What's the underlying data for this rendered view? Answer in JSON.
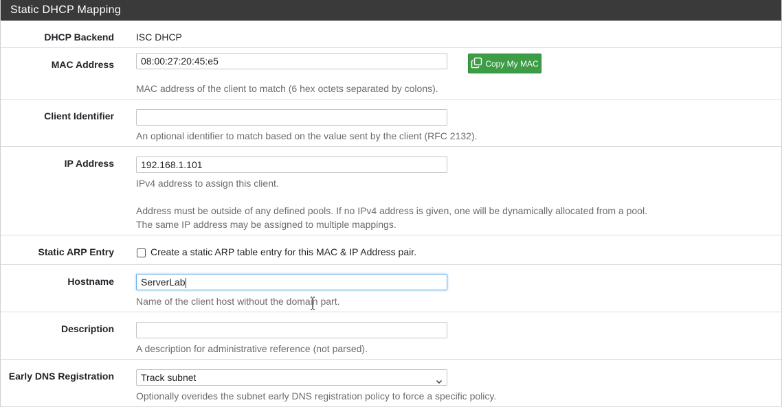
{
  "panel": {
    "title": "Static DHCP Mapping"
  },
  "backend": {
    "label": "DHCP Backend",
    "value": "ISC DHCP"
  },
  "mac": {
    "label": "MAC Address",
    "value": "08:00:27:20:45:e5",
    "button_label": "Copy My MAC",
    "help": "MAC address of the client to match (6 hex octets separated by colons)."
  },
  "client_id": {
    "label": "Client Identifier",
    "value": "",
    "help": "An optional identifier to match based on the value sent by the client (RFC 2132)."
  },
  "ip": {
    "label": "IP Address",
    "value": "192.168.1.101",
    "help1": "IPv4 address to assign this client.",
    "help2": "Address must be outside of any defined pools. If no IPv4 address is given, one will be dynamically allocated from a pool.",
    "help3": "The same IP address may be assigned to multiple mappings."
  },
  "arp": {
    "label": "Static ARP Entry",
    "checkbox_label": "Create a static ARP table entry for this MAC & IP Address pair.",
    "checked": false
  },
  "hostname": {
    "label": "Hostname",
    "value": "ServerLab",
    "help": "Name of the client host without the domain part."
  },
  "description": {
    "label": "Description",
    "value": "",
    "help": "A description for administrative reference (not parsed)."
  },
  "dns": {
    "label": "Early DNS Registration",
    "selected": "Track subnet",
    "help": "Optionally overides the subnet early DNS registration policy to force a specific policy."
  },
  "colors": {
    "heading_bg": "#3a3a3a",
    "button_green": "#3d9c46",
    "focus_blue": "#66afe9"
  },
  "icons": [
    "copy-icon",
    "chevron-down-icon",
    "text-cursor-icon"
  ]
}
